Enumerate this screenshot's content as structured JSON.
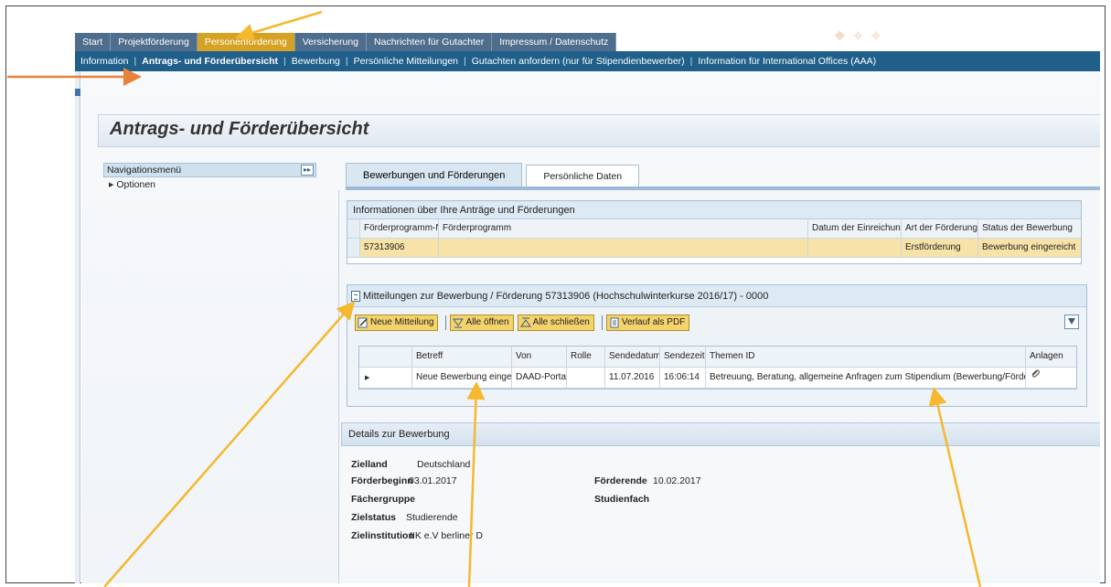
{
  "top_tabs": [
    {
      "label": "Start"
    },
    {
      "label": "Projektförderung"
    },
    {
      "label": "Personenförderung",
      "active": true
    },
    {
      "label": "Versicherung"
    },
    {
      "label": "Nachrichten für Gutachter"
    },
    {
      "label": "Impressum / Datenschutz"
    }
  ],
  "subnav": [
    {
      "label": "Information"
    },
    {
      "label": "Antrags- und Förderübersicht",
      "active": true
    },
    {
      "label": "Bewerbung"
    },
    {
      "label": "Persönliche Mitteilungen"
    },
    {
      "label": "Gutachten anfordern (nur für Stipendienbewerber)"
    },
    {
      "label": "Information für International Offices (AAA)"
    }
  ],
  "page_title": "Antrags- und Förderübersicht",
  "nav_panel": {
    "header": "Navigationsmenü",
    "options_label": "Optionen"
  },
  "content_tabs": [
    {
      "label": "Bewerbungen und Förderungen",
      "active": true
    },
    {
      "label": "Persönliche Daten"
    }
  ],
  "applications": {
    "title": "Informationen über Ihre Anträge und Förderungen",
    "columns": [
      "Förderprogramm-Nr.",
      "Förderprogramm",
      "Datum der Einreichung",
      "Art der Förderung",
      "Status der Bewerbung"
    ],
    "rows": [
      {
        "nr": "57313906",
        "programm": "",
        "datum": "",
        "art": "Erstförderung",
        "status": "Bewerbung eingereicht"
      }
    ]
  },
  "messages": {
    "title": "Mitteilungen zur Bewerbung / Förderung 57313906 (Hochschulwinterkurse 2016/17) - 0000",
    "toolbar": {
      "new_message": "Neue Mitteilung",
      "open_all": "Alle öffnen",
      "close_all": "Alle schließen",
      "history_pdf": "Verlauf als PDF"
    },
    "columns": [
      "Betreff",
      "Von",
      "Rolle",
      "Sendedatum",
      "Sendezeit",
      "Themen ID",
      "Anlagen"
    ],
    "rows": [
      {
        "betreff": "Neue Bewerbung eingereicht",
        "von": "DAAD-Portal",
        "rolle": "",
        "sendedatum": "11.07.2016",
        "sendezeit": "16:06:14",
        "themen": "Betreuung, Beratung, allgemeine Anfragen zum Stipendium (Bewerbung/Förderung)"
      }
    ]
  },
  "details": {
    "title": "Details zur Bewerbung",
    "zielland_label": "Zielland",
    "zielland_value": "Deutschland",
    "foerderbeginn_label": "Förderbeginn",
    "foerderbeginn_value": "03.01.2017",
    "foerderende_label": "Förderende",
    "foerderende_value": "10.02.2017",
    "faechergruppe_label": "Fächergruppe",
    "studienfach_label": "Studienfach",
    "zielstatus_label": "Zielstatus",
    "zielstatus_value": "Studierende",
    "zielinstitution_label": "Zielinstitution",
    "zielinstitution_value": "IIK e.V berliner D"
  },
  "colors": {
    "active_tab": "#d6a224",
    "subnav_bar": "#1f5f8a",
    "highlight_row": "#f7e3a7",
    "arrow_yellow": "#f5b82e",
    "arrow_orange": "#e8823b"
  }
}
